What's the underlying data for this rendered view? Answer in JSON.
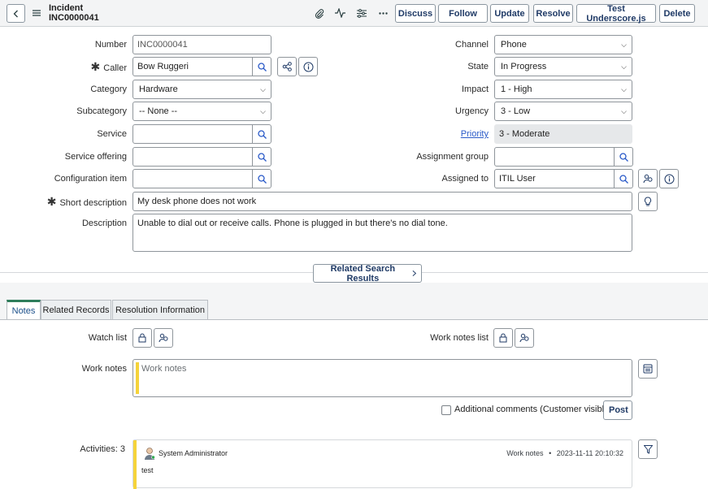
{
  "header": {
    "title": "Incident",
    "number": "INC0000041",
    "buttons": {
      "discuss": "Discuss",
      "follow": "Follow",
      "update": "Update",
      "resolve": "Resolve",
      "test_underscore": "Test Underscore.js",
      "delete": "Delete"
    },
    "icons": [
      "back-icon",
      "menu-icon",
      "paperclip-icon",
      "activity-icon",
      "sliders-icon",
      "more-icon"
    ]
  },
  "form": {
    "number_label": "Number",
    "number_value": "INC0000041",
    "caller_label": "Caller",
    "caller_value": "Bow Ruggeri",
    "category_label": "Category",
    "category_value": "Hardware",
    "subcategory_label": "Subcategory",
    "subcategory_value": "-- None --",
    "service_label": "Service",
    "service_value": "",
    "service_offering_label": "Service offering",
    "service_offering_value": "",
    "config_item_label": "Configuration item",
    "config_item_value": "",
    "short_desc_label": "Short description",
    "short_desc_value": "My desk phone does not work",
    "description_label": "Description",
    "description_value": "Unable to dial out or receive calls. Phone is plugged in but there's no dial tone.",
    "channel_label": "Channel",
    "channel_value": "Phone",
    "state_label": "State",
    "state_value": "In Progress",
    "impact_label": "Impact",
    "impact_value": "1 - High",
    "urgency_label": "Urgency",
    "urgency_value": "3 - Low",
    "priority_label": "Priority",
    "priority_value": "3 - Moderate",
    "assignment_group_label": "Assignment group",
    "assignment_group_value": "",
    "assigned_to_label": "Assigned to",
    "assigned_to_value": "ITIL User",
    "required_mark": "✱"
  },
  "related_search_label": "Related Search Results",
  "tabs": [
    {
      "label": "Notes",
      "active": true
    },
    {
      "label": "Related Records",
      "active": false
    },
    {
      "label": "Resolution Information",
      "active": false
    }
  ],
  "notes": {
    "watch_list_label": "Watch list",
    "work_notes_list_label": "Work notes list",
    "work_notes_label": "Work notes",
    "work_notes_placeholder": "Work notes",
    "additional_comments_label": "Additional comments (Customer visible)",
    "post_label": "Post",
    "activities_label": "Activities: 3"
  },
  "activity": {
    "author": "System Administrator",
    "type": "Work notes",
    "separator": "•",
    "timestamp": "2023-11-11 20:10:32",
    "text": "test"
  },
  "colors": {
    "accent_bar": "#f5d33a",
    "active_tab": "#2e7d5b",
    "link": "#2a5ac8",
    "button_text": "#1f3a66"
  }
}
